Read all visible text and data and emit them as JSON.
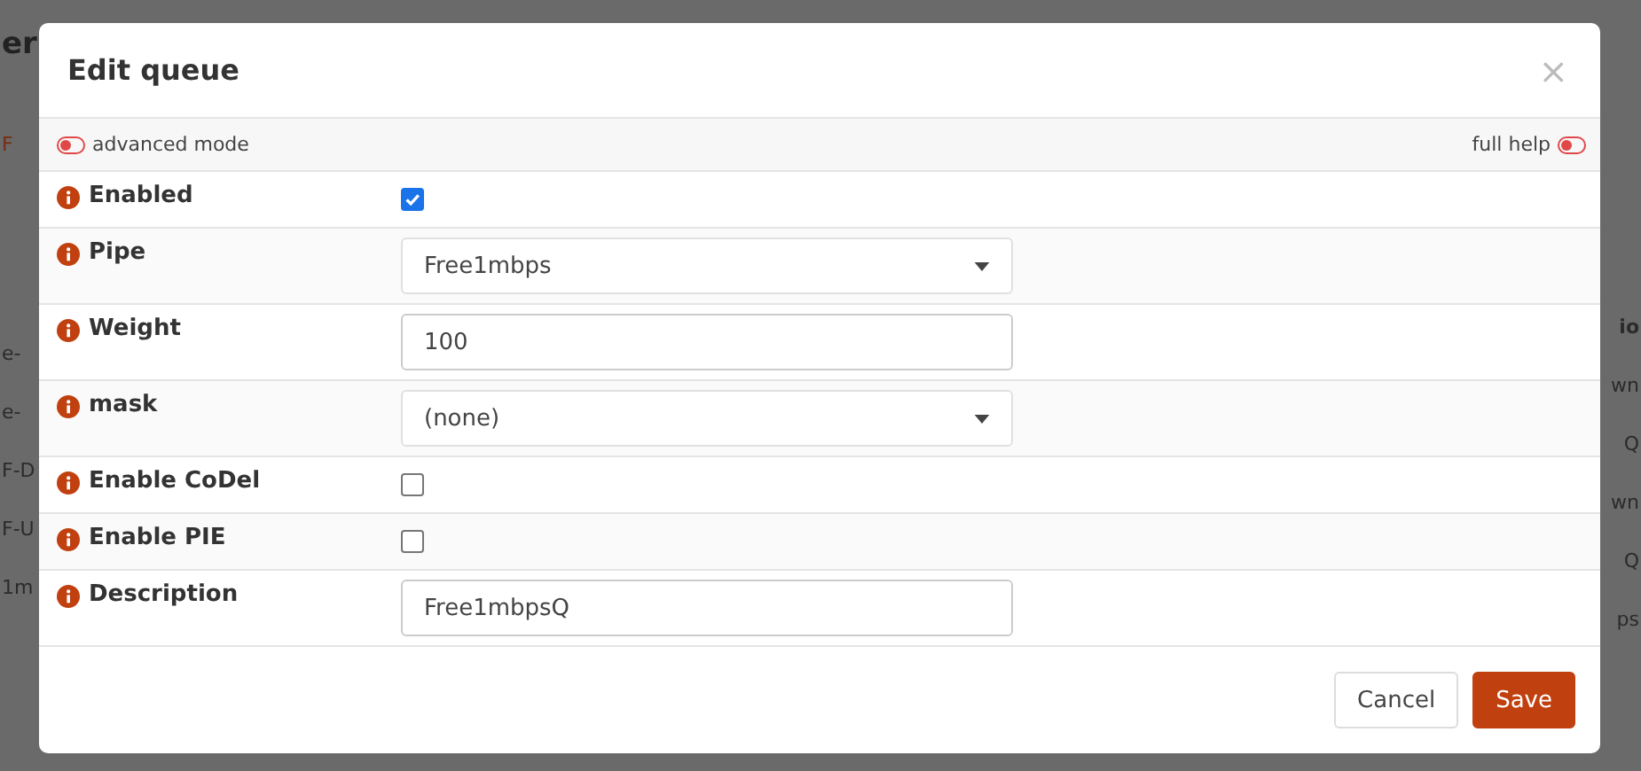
{
  "background_page": {
    "left_fragments": [
      {
        "text": "er",
        "kind": "heading"
      },
      {
        "text": "F",
        "kind": "link"
      },
      {
        "text": "e-",
        "kind": "cell"
      },
      {
        "text": "e-",
        "kind": "cell"
      },
      {
        "text": "F-D",
        "kind": "cell"
      },
      {
        "text": "F-U",
        "kind": "cell"
      },
      {
        "text": "1m",
        "kind": "cell"
      }
    ],
    "right_fragments": [
      {
        "text": "io",
        "kind": "header"
      },
      {
        "text": "wn",
        "kind": "cell"
      },
      {
        "text": "Q",
        "kind": "cell"
      },
      {
        "text": "wn",
        "kind": "cell"
      },
      {
        "text": "Q",
        "kind": "cell"
      },
      {
        "text": "ps",
        "kind": "cell"
      }
    ]
  },
  "dialog": {
    "title": "Edit queue",
    "close": "×",
    "advanced_mode": {
      "label": "advanced mode",
      "on": false
    },
    "full_help": {
      "label": "full help",
      "on": false
    },
    "fields": [
      {
        "kind": "checkbox",
        "label": "Enabled",
        "checked": true
      },
      {
        "kind": "select",
        "label": "Pipe",
        "value": "Free1mbps"
      },
      {
        "kind": "text",
        "label": "Weight",
        "value": "100"
      },
      {
        "kind": "select",
        "label": "mask",
        "value": "(none)"
      },
      {
        "kind": "checkbox",
        "label": "Enable CoDel",
        "checked": false
      },
      {
        "kind": "checkbox",
        "label": "Enable PIE",
        "checked": false
      },
      {
        "kind": "text",
        "label": "Description",
        "value": "Free1mbpsQ"
      }
    ],
    "buttons": [
      {
        "label": "Cancel",
        "kind": "secondary"
      },
      {
        "label": "Save",
        "kind": "primary"
      }
    ]
  }
}
